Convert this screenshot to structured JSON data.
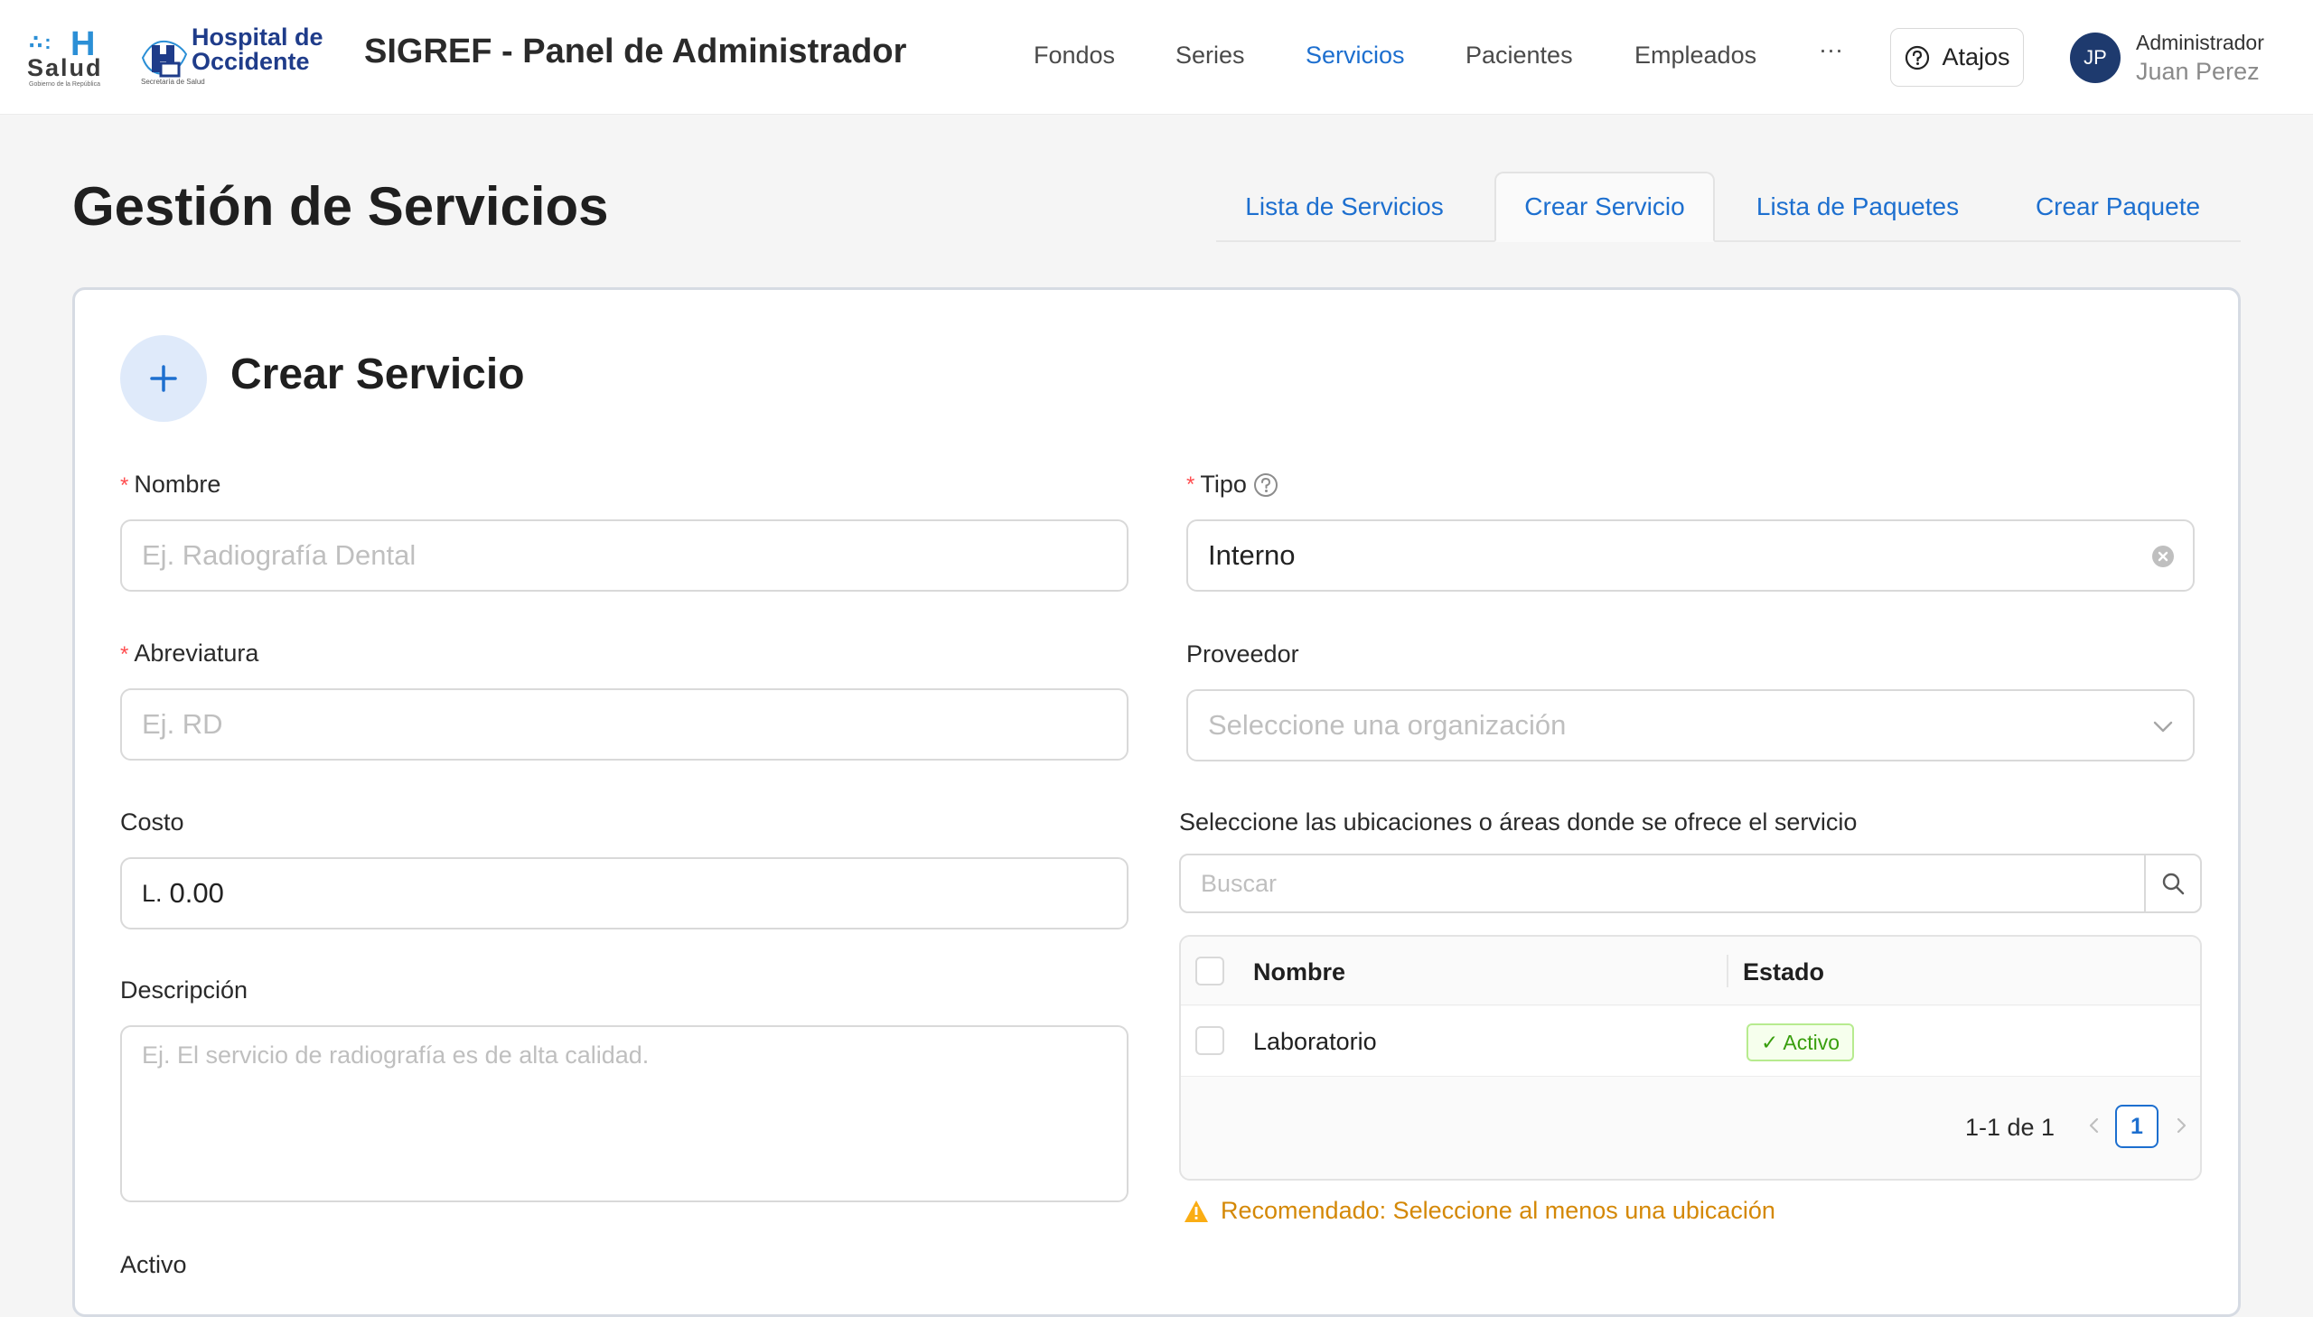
{
  "header": {
    "logo_salud": {
      "letter": "H",
      "word": "Salud",
      "tagline": "Gobierno de la República"
    },
    "logo_hospital": {
      "line1": "Hospital de",
      "line2": "Occidente",
      "subline": "Secretaría de Salud"
    },
    "app_title": "SIGREF - Panel de Administrador",
    "nav": [
      "Fondos",
      "Series",
      "Servicios",
      "Pacientes",
      "Empleados",
      "···"
    ],
    "nav_active": "Servicios",
    "shortcuts_label": "Atajos",
    "user": {
      "initials": "JP",
      "role": "Administrador",
      "name": "Juan Perez"
    }
  },
  "page": {
    "title": "Gestión de Servicios",
    "tabs": [
      "Lista de Servicios",
      "Crear Servicio",
      "Lista de Paquetes",
      "Crear Paquete"
    ],
    "active_tab": "Crear Servicio"
  },
  "form": {
    "card_title": "Crear Servicio",
    "required_mark": "*",
    "nombre": {
      "label": "Nombre",
      "placeholder": "Ej. Radiografía Dental",
      "value": ""
    },
    "abreviatura": {
      "label": "Abreviatura",
      "placeholder": "Ej. RD",
      "value": ""
    },
    "costo": {
      "label": "Costo",
      "prefix": "L.",
      "value": "0.00"
    },
    "descripcion": {
      "label": "Descripción",
      "placeholder": "Ej. El servicio de radiografía es de alta calidad.",
      "value": ""
    },
    "activo": {
      "label": "Activo"
    },
    "tipo": {
      "label": "Tipo",
      "value": "Interno"
    },
    "proveedor": {
      "label": "Proveedor",
      "placeholder": "Seleccione una organización"
    },
    "ubicaciones": {
      "label": "Seleccione las ubicaciones o áreas donde se ofrece el servicio",
      "search_placeholder": "Buscar",
      "columns": [
        "Nombre",
        "Estado"
      ],
      "rows": [
        {
          "nombre": "Laboratorio",
          "estado": "✓ Activo"
        }
      ],
      "pagination": {
        "summary": "1-1 de 1",
        "current_page": "1"
      },
      "warning": "Recomendado: Seleccione al menos una ubicación"
    }
  },
  "colors": {
    "primary": "#1d6fcf",
    "required": "#ff4d4f",
    "success": "#389e0d",
    "warning": "#d48806",
    "avatar_bg": "#1e3a6e"
  }
}
